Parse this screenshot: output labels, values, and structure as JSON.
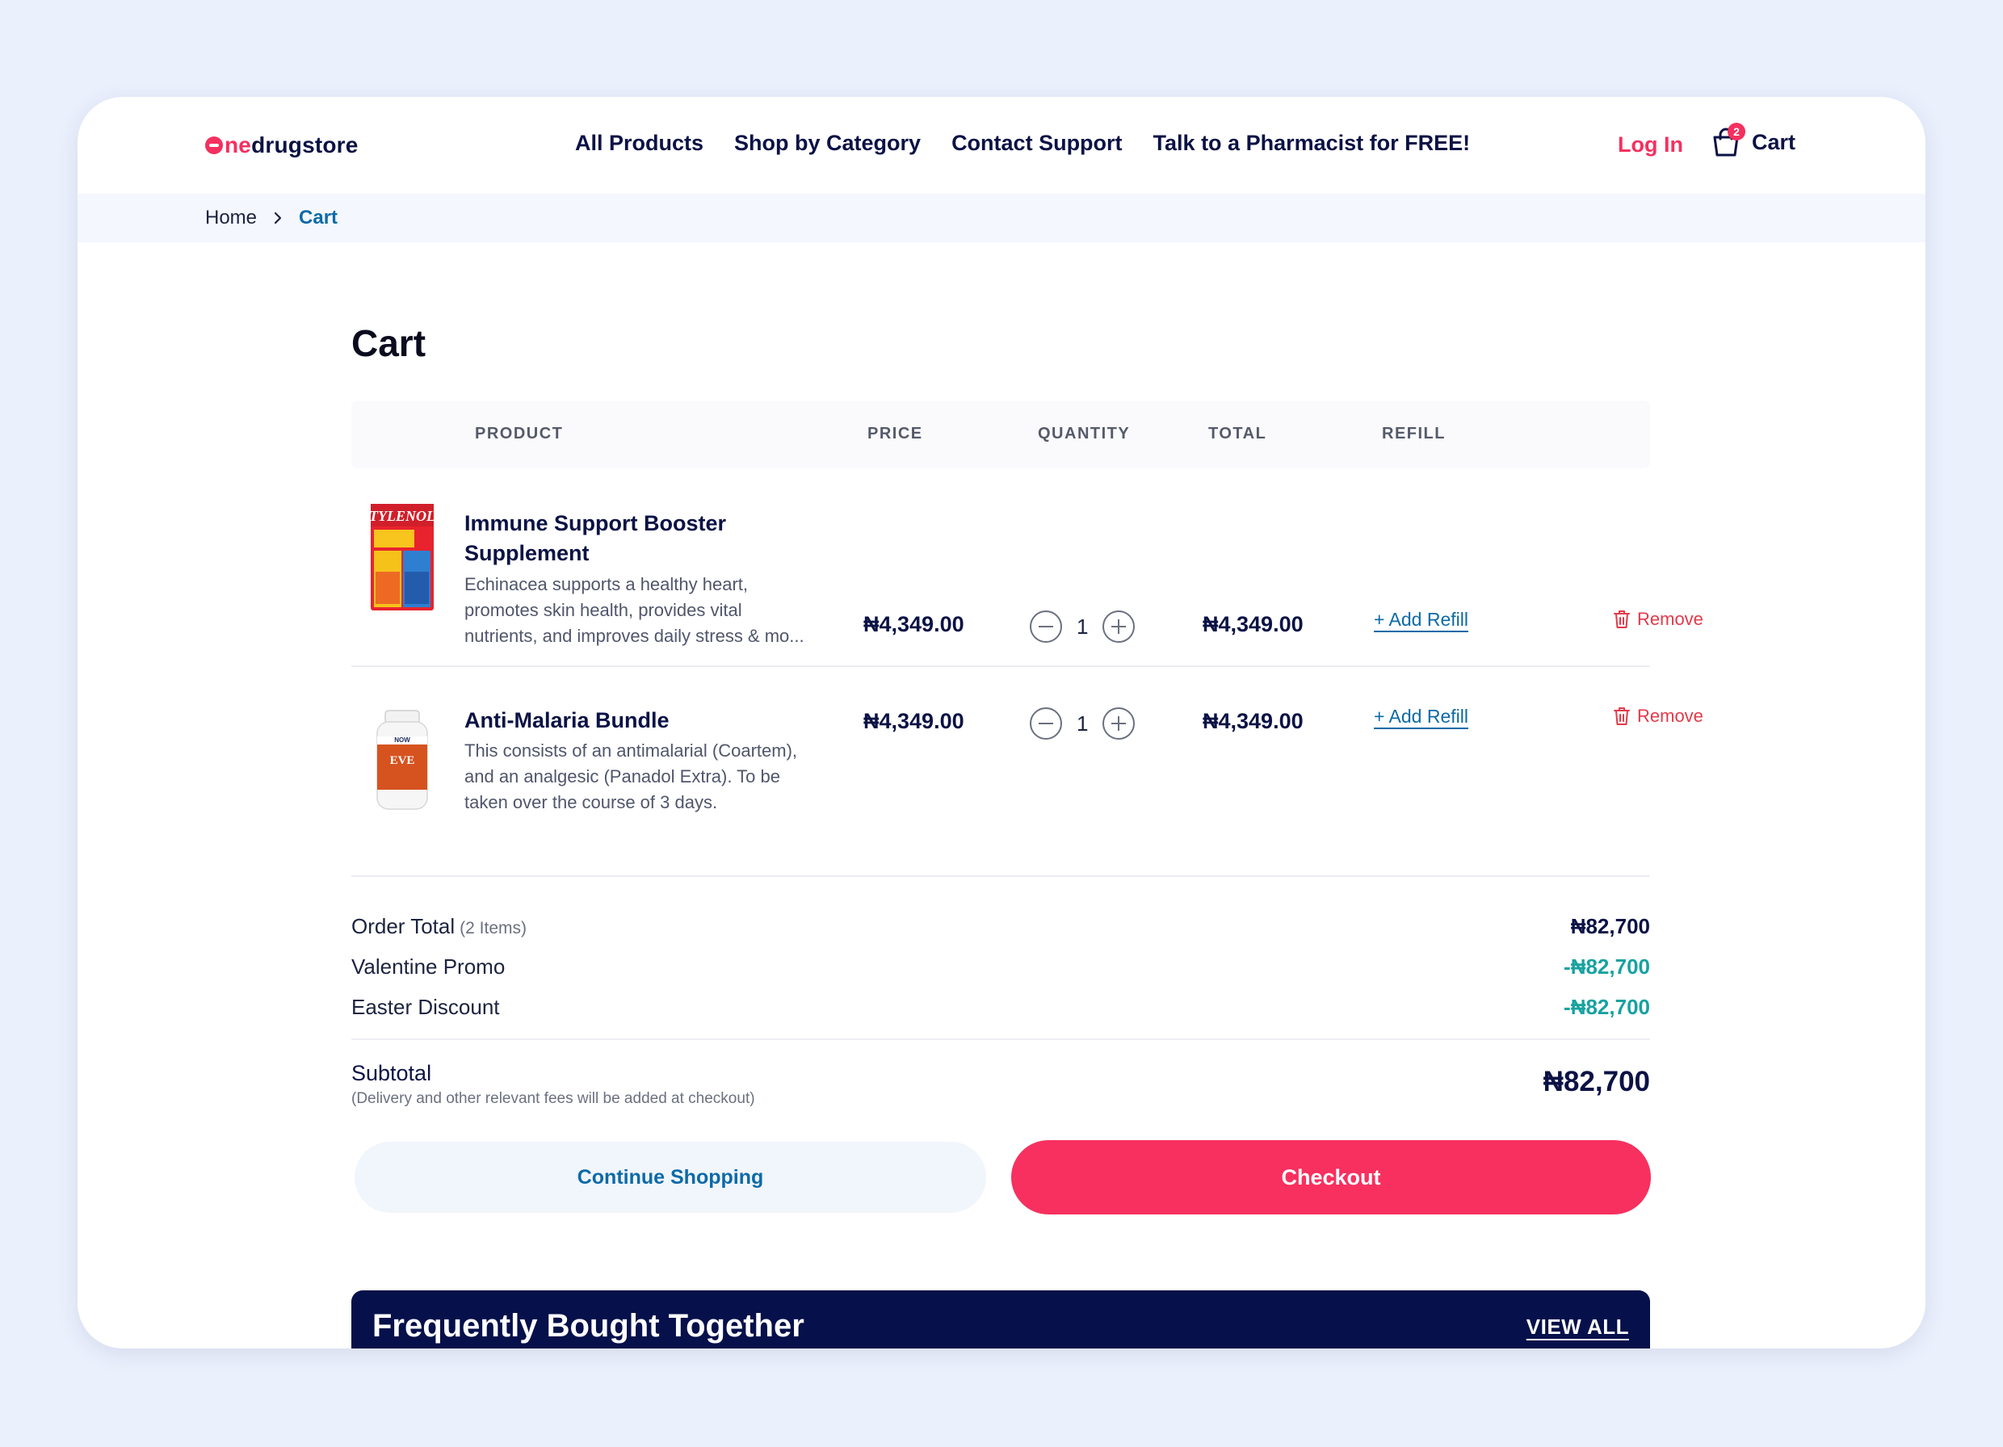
{
  "brand": {
    "logo_prefix": "ne",
    "logo_suffix": "drugstore"
  },
  "nav": {
    "items": [
      "All Products",
      "Shop by Category",
      "Contact Support",
      "Talk to a Pharmacist for FREE!"
    ]
  },
  "header": {
    "login_label": "Log In",
    "cart_label": "Cart",
    "cart_count": "2"
  },
  "breadcrumb": {
    "home": "Home",
    "current": "Cart"
  },
  "page": {
    "title": "Cart"
  },
  "table": {
    "columns": [
      "PRODUCT",
      "PRICE",
      "QUANTITY",
      "TOTAL",
      "REFILL"
    ]
  },
  "items": [
    {
      "name": "Immune Support Booster Supplement",
      "description": "Echinacea supports a healthy heart, promotes skin health, provides vital nutrients, and improves daily stress & mo...",
      "price": "₦4,349.00",
      "quantity": "1",
      "total": "₦4,349.00",
      "refill_label": "+ Add Refill",
      "remove_label": "Remove",
      "image_icon": "tylenol-box-icon"
    },
    {
      "name": "Anti-Malaria Bundle",
      "description": "This consists of an antimalarial (Coartem), and an analgesic (Panadol Extra). To be taken over the course of 3 days.",
      "price": "₦4,349.00",
      "quantity": "1",
      "total": "₦4,349.00",
      "refill_label": "+ Add Refill",
      "remove_label": "Remove",
      "image_icon": "supplement-bottle-icon"
    }
  ],
  "summary": {
    "order_total_label": "Order Total",
    "order_total_count": "(2 Items)",
    "order_total_amount": "₦82,700",
    "promos": [
      {
        "label": "Valentine Promo",
        "amount": "-₦82,700"
      },
      {
        "label": "Easter Discount",
        "amount": "-₦82,700"
      }
    ],
    "subtotal_label": "Subtotal",
    "subtotal_note": "(Delivery and other relevant fees will be added at checkout)",
    "subtotal_amount": "₦82,700"
  },
  "actions": {
    "continue_label": "Continue Shopping",
    "checkout_label": "Checkout"
  },
  "fbt": {
    "title": "Frequently Bought Together",
    "view_all": "VIEW ALL"
  },
  "colors": {
    "accent": "#f7305f",
    "navy": "#06104a",
    "link": "#0c6aa7",
    "discount": "#17a2a0",
    "background": "#ebf0fd"
  }
}
